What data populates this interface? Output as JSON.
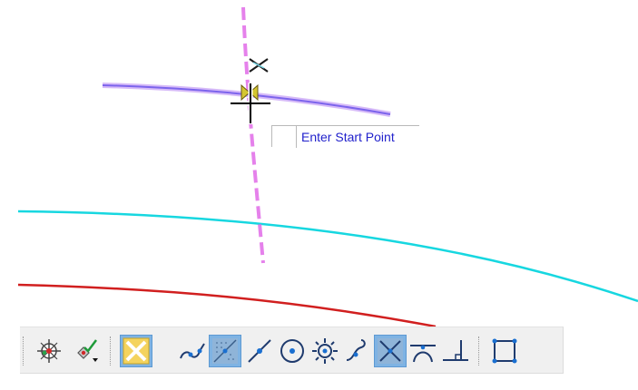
{
  "view": {
    "prompt": {
      "text": "Enter Start Point"
    }
  },
  "snap_toolbar": {
    "buttons": [
      {
        "name": "accusnap-toggle-icon",
        "selected": false
      },
      {
        "name": "snap-mode-menu-icon",
        "selected": false
      },
      {
        "name": "intersection-snap-icon",
        "selected": true
      },
      {
        "name": "keypoint-snap-icon",
        "selected": false
      },
      {
        "name": "nearest-snap-icon",
        "selected": true
      },
      {
        "name": "midpoint-snap-icon",
        "selected": false
      },
      {
        "name": "center-snap-icon",
        "selected": false
      },
      {
        "name": "origin-snap-icon",
        "selected": false
      },
      {
        "name": "bisector-snap-icon",
        "selected": false
      },
      {
        "name": "intersection-snap-alt-icon",
        "selected": true
      },
      {
        "name": "tangent-snap-icon",
        "selected": false
      },
      {
        "name": "perpendicular-snap-icon",
        "selected": false
      },
      {
        "name": "box-snap-icon",
        "selected": false
      }
    ]
  },
  "colors": {
    "construction_line": "#e06be8",
    "highlight_line": "#8e7ef0",
    "cyan_curve": "#17d7e0",
    "red_curve": "#d11f1f",
    "selected_button": "#7fb3e3",
    "prompt_text": "#2222cc"
  }
}
